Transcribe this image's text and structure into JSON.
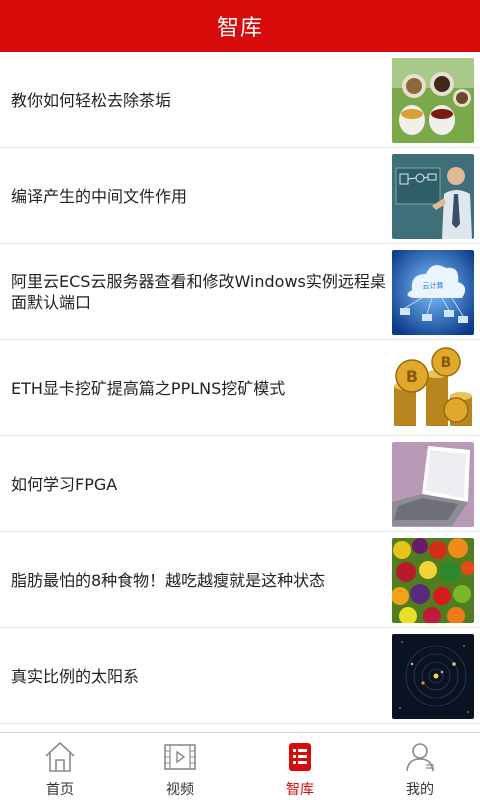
{
  "header": {
    "title": "智库"
  },
  "articles": [
    {
      "title": "教你如何轻松去除茶垢",
      "thumb_icon": "tea-cups-image"
    },
    {
      "title": "编译产生的中间文件作用",
      "thumb_icon": "businessman-whiteboard-image"
    },
    {
      "title": "阿里云ECS云服务器查看和修改Windows实例远程桌面默认端口",
      "thumb_icon": "cloud-computing-image",
      "thumb_text": "云计算"
    },
    {
      "title": "ETH显卡挖矿提高篇之PPLNS挖矿模式",
      "thumb_icon": "bitcoin-coins-image"
    },
    {
      "title": "如何学习FPGA",
      "thumb_icon": "laptop-image"
    },
    {
      "title": "脂肪最怕的8种食物！越吃越瘦就是这种状态",
      "thumb_icon": "vegetables-fruits-image"
    },
    {
      "title": "真实比例的太阳系",
      "thumb_icon": "solar-system-image"
    }
  ],
  "tabbar": {
    "tabs": [
      {
        "label": "首页",
        "icon": "home-icon",
        "active": false
      },
      {
        "label": "视频",
        "icon": "video-icon",
        "active": false
      },
      {
        "label": "智库",
        "icon": "list-icon",
        "active": true
      },
      {
        "label": "我的",
        "icon": "user-icon",
        "active": false
      }
    ]
  },
  "colors": {
    "brand": "#d80b0b",
    "text": "#222222",
    "tab_inactive": "#333333"
  }
}
